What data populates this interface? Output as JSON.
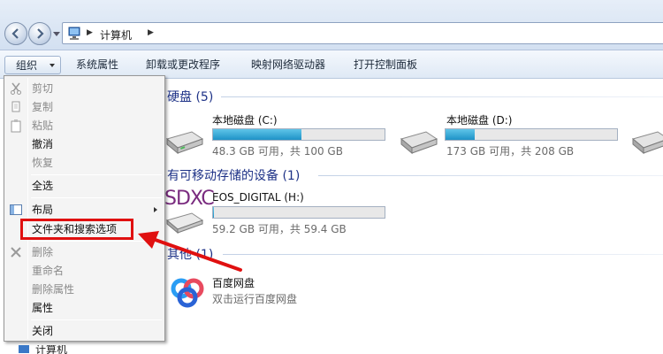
{
  "address": {
    "crumb": "计算机",
    "sep": "▶"
  },
  "toolbar": {
    "organize": "组织",
    "system_properties": "系统属性",
    "uninstall": "卸载或更改程序",
    "map_drive": "映射网络驱动器",
    "control_panel": "打开控制面板"
  },
  "groups": {
    "hdd": "硬盘 (5)",
    "removable": "有可移动存储的设备 (1)",
    "other": "其他 (1)"
  },
  "drives": [
    {
      "name": "本地磁盘 (C:)",
      "size": "48.3 GB 可用，共 100 GB",
      "used_fraction": 0.517
    },
    {
      "name": "本地磁盘 (D:)",
      "size": "173 GB 可用，共 208 GB",
      "used_fraction": 0.168
    },
    {
      "name": "EOS_DIGITAL (H:)",
      "size": "59.2 GB 可用，共 59.4 GB",
      "used_fraction": 0.004
    }
  ],
  "sdxc_logo": "SDXC",
  "other_item": {
    "name": "百度网盘",
    "desc": "双击运行百度网盘"
  },
  "menu": {
    "cut": "剪切",
    "copy": "复制",
    "paste": "粘贴",
    "undo": "撤消",
    "redo": "恢复",
    "select_all": "全选",
    "layout": "布局",
    "folder_options": "文件夹和搜索选项",
    "delete": "删除",
    "rename": "重命名",
    "remove_props": "删除属性",
    "properties": "属性",
    "close": "关闭"
  },
  "nav_tree": {
    "computer": "计算机"
  },
  "colors": {
    "highlight": "#e01010",
    "bar_fill": "#1e93c7",
    "group_text": "#1e3287"
  }
}
